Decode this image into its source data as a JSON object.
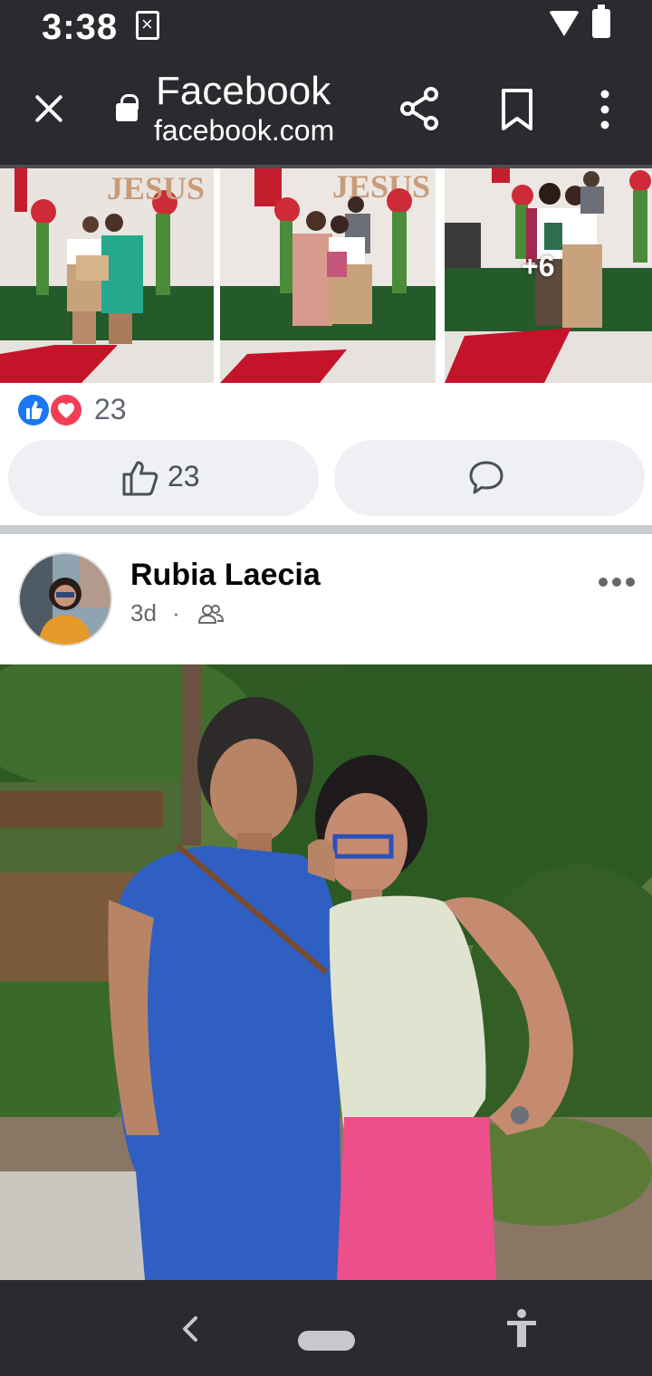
{
  "status_bar": {
    "time": "3:38"
  },
  "browser": {
    "title": "Facebook",
    "url": "facebook.com"
  },
  "photo_grid": {
    "more_count": "+6"
  },
  "reactions": {
    "count": "23"
  },
  "actions": {
    "like_count": "23"
  },
  "post": {
    "author": "Rubia Laecia",
    "time": "3d",
    "separator": "·"
  },
  "colors": {
    "facebook_blue": "#1877f2",
    "love_red": "#f33e58",
    "chrome_bg": "#2b2b2f"
  },
  "icons": [
    "close-icon",
    "lock-icon",
    "share-icon",
    "bookmark-icon",
    "more-vert-icon",
    "like-icon",
    "love-icon",
    "thumbs-up-icon",
    "comment-icon",
    "friends-icon",
    "more-horiz-icon",
    "back-icon",
    "accessibility-icon"
  ]
}
